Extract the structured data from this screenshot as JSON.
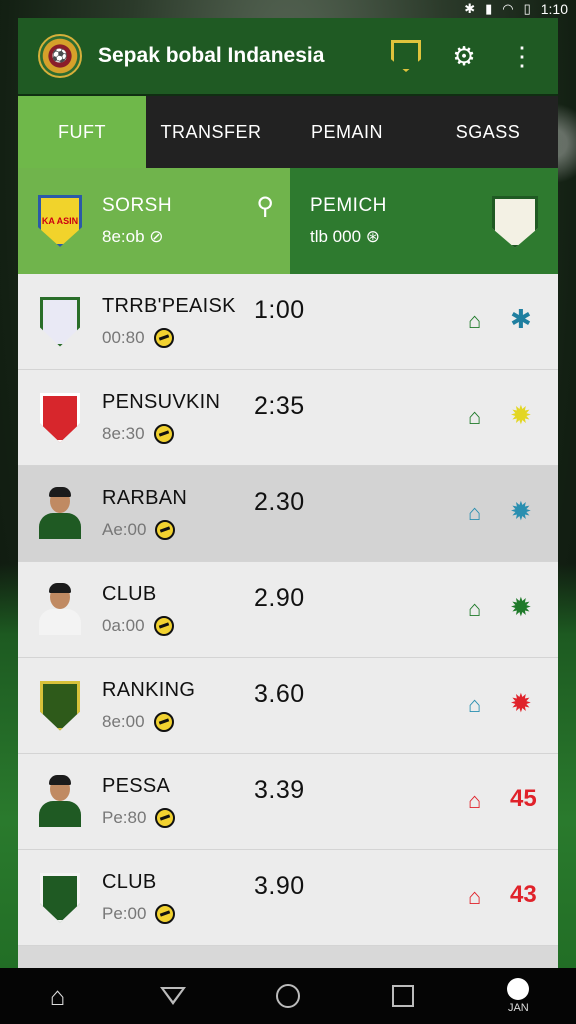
{
  "status_bar": {
    "time": "1:10",
    "icons": [
      "bluetooth-icon",
      "signal-icon",
      "wifi-icon",
      "battery-icon"
    ]
  },
  "header": {
    "title": "Sepak bobal Indanesia",
    "logo_icon": "club-logo-icon",
    "badge_icon": "shield-badge-icon",
    "settings_icon": "gear-icon",
    "menu_icon": "more-vert-icon"
  },
  "tabs": [
    {
      "label": "FUFT",
      "active": true
    },
    {
      "label": "TRANSFER",
      "active": false
    },
    {
      "label": "PEMAIN",
      "active": false
    },
    {
      "label": "SGASS",
      "active": false
    }
  ],
  "banner": {
    "left": {
      "crest_text": "KA ASIN",
      "title": "SORSH",
      "subtitle": "8e:ob",
      "icon": "search-icon"
    },
    "right": {
      "title": "PEMICH",
      "subtitle": "tlb 000"
    }
  },
  "rows": [
    {
      "name": "TRRB'PEAISK",
      "sub": "00:80",
      "value": "1:00",
      "house_color": "#1f7a2a",
      "action": "✱",
      "action_color": "#1f7fa0",
      "avatar": "crest",
      "av_color": "#e9e9f5",
      "av_accent": "#2a6e2a"
    },
    {
      "name": "PENSUVKIN",
      "sub": "8e:30",
      "value": "2:35",
      "house_color": "#1f7a2a",
      "action": "✹",
      "action_color": "#e3d622",
      "avatar": "crest",
      "av_color": "#d7262c",
      "av_accent": "#fff"
    },
    {
      "name": "RARBAN",
      "sub": "Ae:00",
      "value": "2.30",
      "house_color": "#2a8fb0",
      "action": "✹",
      "action_color": "#2a8fb0",
      "avatar": "person",
      "av_color": "#1f5a23",
      "highlight": true
    },
    {
      "name": "CLUB",
      "sub": "0a:00",
      "value": "2.90",
      "house_color": "#1f7a2a",
      "action": "✹",
      "action_color": "#1f7a2a",
      "avatar": "person",
      "av_color": "#f3f3f3"
    },
    {
      "name": "RANKING",
      "sub": "8e:00",
      "value": "3.60",
      "house_color": "#2a8fb0",
      "action": "✹",
      "action_color": "#e0222a",
      "avatar": "crest",
      "av_color": "#2e5a1a",
      "av_accent": "#d7c23a"
    },
    {
      "name": "PESSA",
      "sub": "Pe:80",
      "value": "3.39",
      "house_color": "#e0222a",
      "action": "45",
      "action_color": "#e0222a",
      "avatar": "person",
      "av_color": "#1f5a23"
    },
    {
      "name": "CLUB",
      "sub": "Pe:00",
      "value": "3.90",
      "house_color": "#e0222a",
      "action": "43",
      "action_color": "#e0222a",
      "avatar": "crest",
      "av_color": "#1f5a23",
      "av_accent": "#f3f3f3"
    }
  ],
  "navbar": {
    "items": [
      "home-icon",
      "back-icon",
      "home-circle-icon",
      "recents-icon",
      "profile-icon"
    ],
    "profile_label": "JAN"
  }
}
